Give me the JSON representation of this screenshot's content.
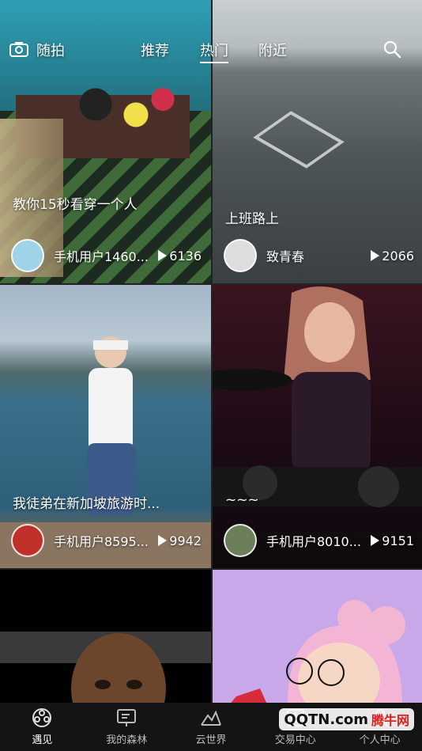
{
  "header": {
    "tabs": [
      {
        "label": "随拍"
      },
      {
        "label": "推荐"
      },
      {
        "label": "热门",
        "active": true
      },
      {
        "label": "附近"
      }
    ],
    "camera_icon": "camera-icon",
    "search_icon": "search-icon"
  },
  "cards": [
    {
      "caption": "教你15秒看穿一个人",
      "author": "手机用户1460...",
      "plays": "6136"
    },
    {
      "caption": "上班路上",
      "author": "致青春",
      "plays": "2066"
    },
    {
      "caption": "我徒弟在新加坡旅游时...",
      "author": "手机用户8595...",
      "plays": "9942"
    },
    {
      "caption": "~~~",
      "author": "手机用户8010...",
      "plays": "9151"
    },
    {
      "caption": "",
      "author": "",
      "plays": ""
    },
    {
      "caption": "",
      "author": "",
      "plays": ""
    }
  ],
  "nav": {
    "items": [
      {
        "label": "遇见",
        "icon": "film-reel-icon",
        "active": true
      },
      {
        "label": "我的森林",
        "icon": "forest-board-icon"
      },
      {
        "label": "云世界",
        "icon": "mountain-icon"
      },
      {
        "label": "交易中心",
        "icon": "trade-icon"
      },
      {
        "label": "个人中心",
        "icon": "person-icon"
      }
    ]
  },
  "watermark": {
    "logo": "QQTN.com",
    "text": "腾牛网"
  },
  "colors": {
    "nav_bg": "#141414",
    "accent": "#ffffff"
  }
}
